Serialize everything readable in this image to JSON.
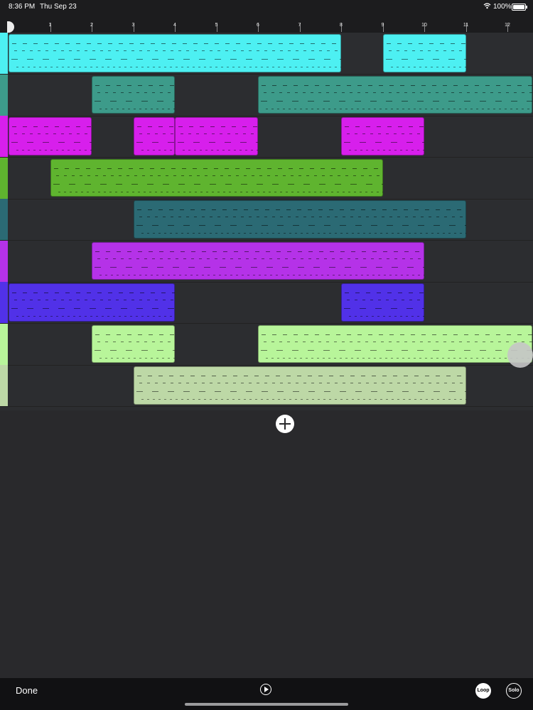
{
  "status": {
    "time": "8:36 PM",
    "date": "Thu Sep 23",
    "battery": "100%"
  },
  "ruler": {
    "labels": [
      "1",
      "2",
      "3",
      "4",
      "5",
      "6",
      "7",
      "8",
      "9",
      "10",
      "11",
      "12"
    ]
  },
  "tracks": [
    {
      "color": "#4df0f2",
      "regions": [
        {
          "start": 0,
          "end": 8
        },
        {
          "start": 9,
          "end": 11
        }
      ]
    },
    {
      "color": "#3d9b8a",
      "regions": [
        {
          "start": 2,
          "end": 4
        },
        {
          "start": 6,
          "end": 12.6
        }
      ]
    },
    {
      "color": "#d71fec",
      "regions": [
        {
          "start": 0,
          "end": 2
        },
        {
          "start": 3,
          "end": 4
        },
        {
          "start": 4,
          "end": 6
        },
        {
          "start": 8,
          "end": 10
        }
      ]
    },
    {
      "color": "#5fb42f",
      "regions": [
        {
          "start": 1,
          "end": 9
        }
      ]
    },
    {
      "color": "#2b6a74",
      "regions": [
        {
          "start": 3,
          "end": 11
        }
      ]
    },
    {
      "color": "#b532e8",
      "regions": [
        {
          "start": 2,
          "end": 10
        }
      ]
    },
    {
      "color": "#5131e8",
      "regions": [
        {
          "start": 0,
          "end": 4
        },
        {
          "start": 8,
          "end": 10
        }
      ]
    },
    {
      "color": "#b8f59a",
      "regions": [
        {
          "start": 2,
          "end": 4
        },
        {
          "start": 6,
          "end": 12.6
        }
      ]
    },
    {
      "color": "#bdd8a6",
      "regions": [
        {
          "start": 3,
          "end": 11
        }
      ]
    }
  ],
  "bottom": {
    "done": "Done",
    "loop": "Loop",
    "solo": "Solo"
  }
}
